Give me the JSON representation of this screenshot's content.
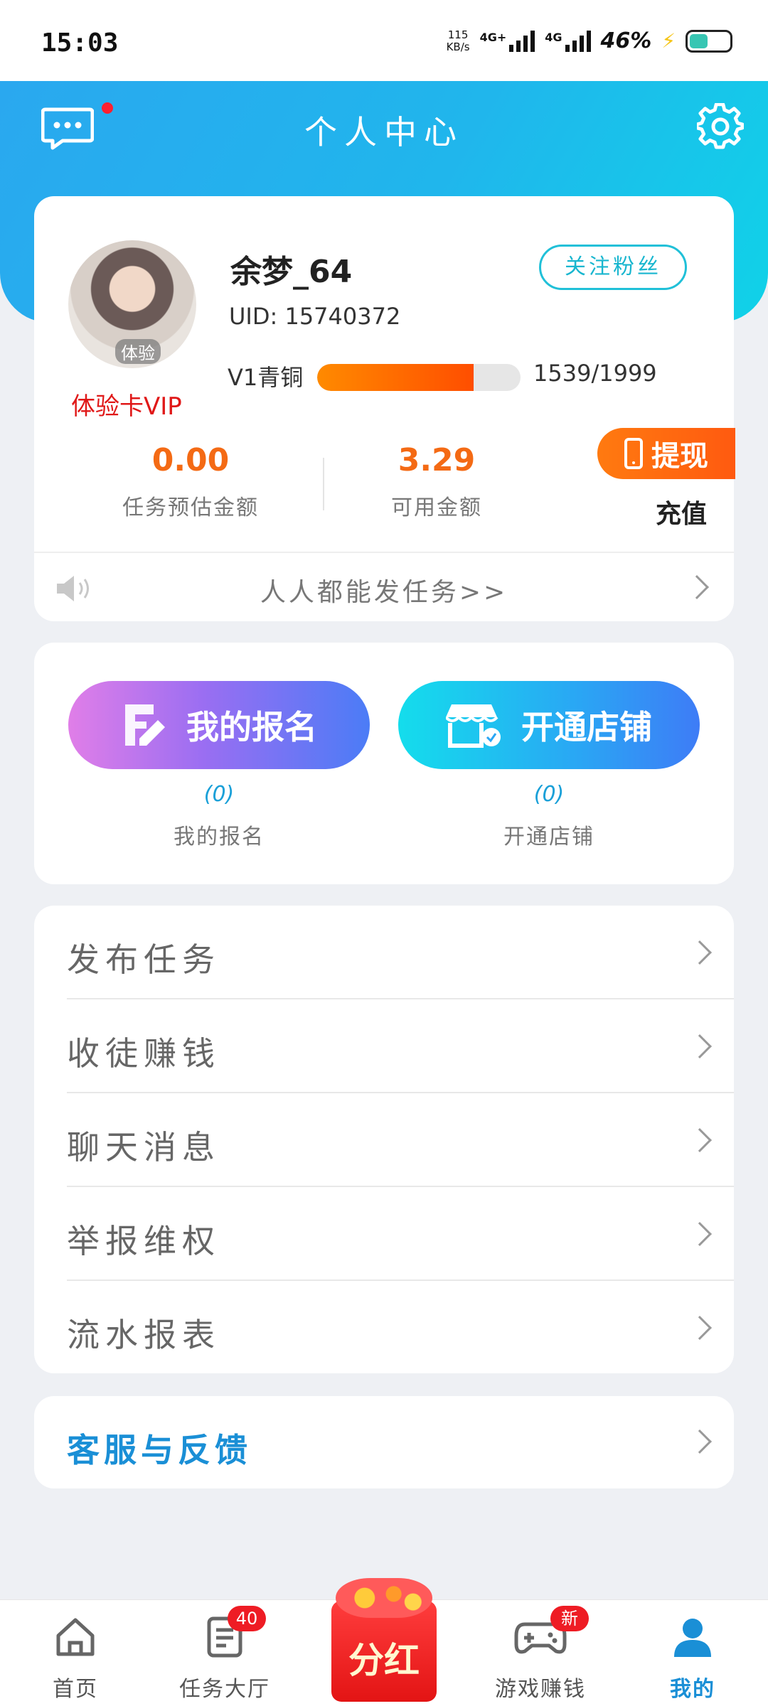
{
  "status_bar": {
    "time": "15:03",
    "speed_value": "115",
    "speed_unit": "KB/s",
    "net1": "4G+",
    "net2": "4G",
    "battery": "46%"
  },
  "header": {
    "title": "个人中心"
  },
  "profile": {
    "avatar_badge": "体验",
    "vip_label": "体验卡VIP",
    "username": "余梦_64",
    "uid": "UID: 15740372",
    "follow_label": "关注粉丝",
    "level_label": "V1青铜",
    "level_progress": 0.77,
    "level_count": "1539/1999",
    "estimated_amount": "0.00",
    "estimated_label": "任务预估金额",
    "available_amount": "3.29",
    "available_label": "可用金额",
    "withdraw_label": "提现",
    "recharge_label": "充值",
    "notice": "人人都能发任务>>"
  },
  "signup": {
    "my_signup_label": "我的报名",
    "my_signup_count": "(0)",
    "my_signup_caption": "我的报名",
    "open_shop_label": "开通店铺",
    "open_shop_count": "(0)",
    "open_shop_caption": "开通店铺"
  },
  "menu": [
    {
      "label": "发布任务"
    },
    {
      "label": "收徒赚钱"
    },
    {
      "label": "聊天消息"
    },
    {
      "label": "举报维权"
    },
    {
      "label": "流水报表"
    }
  ],
  "service": {
    "label": "客服与反馈"
  },
  "nav": {
    "home": "首页",
    "tasks": "任务大厅",
    "tasks_badge": "40",
    "dividend": "分红",
    "games": "游戏赚钱",
    "games_badge": "新",
    "mine": "我的"
  },
  "colors": {
    "accent": "#1a8fd6",
    "orange": "#f46a14",
    "header_start": "#2aa8ef",
    "header_end": "#10d2e8"
  }
}
